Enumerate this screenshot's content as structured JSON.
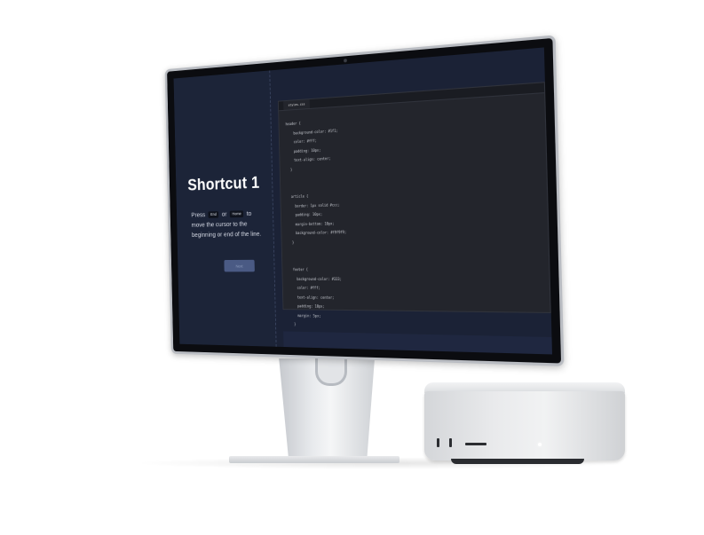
{
  "lesson": {
    "title": "Shortcut 1",
    "instruction_prefix": "Press",
    "key_1": "End",
    "instruction_or": "or",
    "key_2": "Home",
    "instruction_suffix": "to move the cursor to the beginning or end of the line.",
    "next_button_label": "Next"
  },
  "editor": {
    "tab_label": "styles.css",
    "code_lines": [
      "header {",
      "    background-color: #1f1;",
      "    color: #fff;",
      "    padding: 10px;",
      "    text-align: center;",
      "  }",
      "",
      "",
      "  article {",
      "    border: 1px solid #ccc;",
      "    padding: 10px;",
      "    margin-bottom: 10px;",
      "    background-color: #f9f9f9;",
      "  }",
      "",
      "",
      "  footer {",
      "    background-color: #333;",
      "    color: #fff;",
      "    text-align: center;",
      "    padding: 10px;",
      "    margin: 5px;",
      "  }"
    ]
  },
  "colors": {
    "screen_background": "#1b2236",
    "editor_background": "#23252c",
    "button_background": "#4a5a84"
  },
  "icons": [
    "camera-icon",
    "power-led-icon"
  ]
}
